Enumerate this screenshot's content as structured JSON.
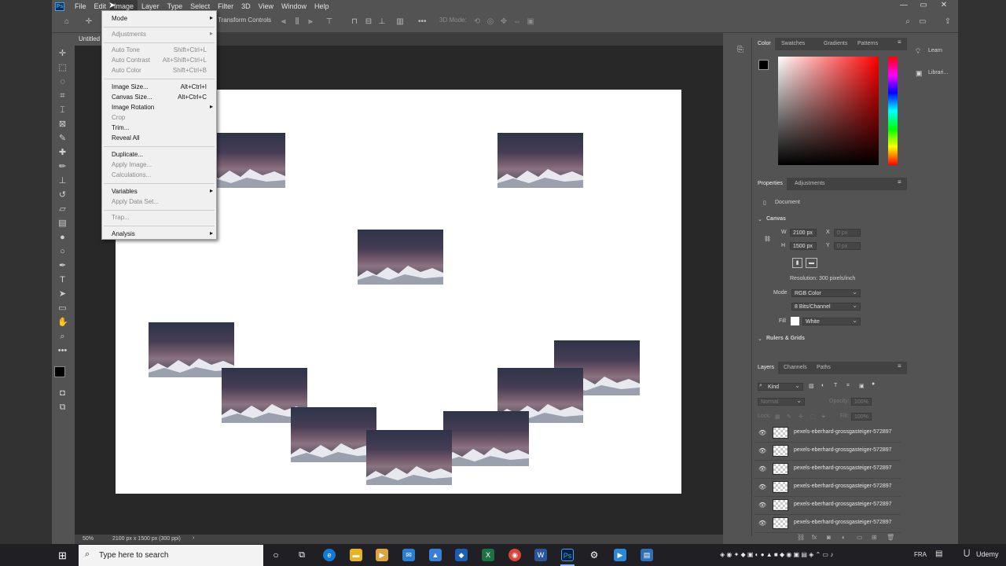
{
  "menubar": {
    "logo": "Ps",
    "items": [
      "File",
      "Edit",
      "Image",
      "Layer",
      "Type",
      "Select",
      "Filter",
      "3D",
      "View",
      "Window",
      "Help"
    ],
    "active": "Image",
    "window_controls": [
      "—",
      "▭",
      "✕"
    ]
  },
  "optionsbar": {
    "show_transform_controls": "Transform Controls",
    "mode_3d": "3D Mode:"
  },
  "document": {
    "tab_title": "Untitled"
  },
  "image_menu": {
    "items": [
      {
        "label": "Mode",
        "shortcut": "",
        "submenu": true,
        "enabled": true
      },
      {
        "label": "Adjustments",
        "shortcut": "",
        "submenu": true,
        "enabled": false
      },
      {
        "label": "Auto Tone",
        "shortcut": "Shift+Ctrl+L",
        "submenu": false,
        "enabled": false
      },
      {
        "label": "Auto Contrast",
        "shortcut": "Alt+Shift+Ctrl+L",
        "submenu": false,
        "enabled": false
      },
      {
        "label": "Auto Color",
        "shortcut": "Shift+Ctrl+B",
        "submenu": false,
        "enabled": false
      },
      {
        "label": "Image Size...",
        "shortcut": "Alt+Ctrl+I",
        "submenu": false,
        "enabled": true
      },
      {
        "label": "Canvas Size...",
        "shortcut": "Alt+Ctrl+C",
        "submenu": false,
        "enabled": true
      },
      {
        "label": "Image Rotation",
        "shortcut": "",
        "submenu": true,
        "enabled": true
      },
      {
        "label": "Crop",
        "shortcut": "",
        "submenu": false,
        "enabled": false
      },
      {
        "label": "Trim...",
        "shortcut": "",
        "submenu": false,
        "enabled": true
      },
      {
        "label": "Reveal All",
        "shortcut": "",
        "submenu": false,
        "enabled": true
      },
      {
        "label": "Duplicate...",
        "shortcut": "",
        "submenu": false,
        "enabled": true
      },
      {
        "label": "Apply Image...",
        "shortcut": "",
        "submenu": false,
        "enabled": false
      },
      {
        "label": "Calculations...",
        "shortcut": "",
        "submenu": false,
        "enabled": false
      },
      {
        "label": "Variables",
        "shortcut": "",
        "submenu": true,
        "enabled": true
      },
      {
        "label": "Apply Data Set...",
        "shortcut": "",
        "submenu": false,
        "enabled": false
      },
      {
        "label": "Trap...",
        "shortcut": "",
        "submenu": false,
        "enabled": false
      },
      {
        "label": "Analysis",
        "shortcut": "",
        "submenu": true,
        "enabled": true
      }
    ]
  },
  "color_panel": {
    "tabs": [
      "Color",
      "Swatches",
      "Gradients",
      "Patterns"
    ],
    "active_tab": "Color",
    "foreground": "#000000",
    "background": "#ffffff"
  },
  "properties_panel": {
    "tabs": [
      "Properties",
      "Adjustments"
    ],
    "active_tab": "Properties",
    "doc_label": "Document",
    "canvas_section": "Canvas",
    "width_label": "W",
    "width_value": "2100 px",
    "height_label": "H",
    "height_value": "1500 px",
    "x_label": "X",
    "x_placeholder": "0 px",
    "y_label": "Y",
    "y_placeholder": "0 px",
    "resolution": "Resolution: 300 pixels/inch",
    "mode_label": "Mode",
    "mode_value": "RGB Color",
    "depth_value": "8 Bits/Channel",
    "fill_label": "Fill",
    "fill_value": "White",
    "rulers_section": "Rulers & Grids"
  },
  "layers_panel": {
    "tabs": [
      "Layers",
      "Channels",
      "Paths"
    ],
    "active_tab": "Layers",
    "filter_kind": "Kind",
    "blend_mode": "Normal",
    "opacity_label": "Opacity:",
    "opacity_value": "100%",
    "lock_label": "Lock:",
    "fill_label": "Fill:",
    "fill_value": "100%",
    "layers": [
      {
        "name": "pexels-eberhard-grossgasteiger-572897"
      },
      {
        "name": "pexels-eberhard-grossgasteiger-572897"
      },
      {
        "name": "pexels-eberhard-grossgasteiger-572897"
      },
      {
        "name": "pexels-eberhard-grossgasteiger-572897"
      },
      {
        "name": "pexels-eberhard-grossgasteiger-572897"
      },
      {
        "name": "pexels-eberhard-grossgasteiger-572897"
      }
    ]
  },
  "learn_panel": {
    "items": [
      "Learn",
      "Librari..."
    ]
  },
  "statusbar": {
    "zoom": "50%",
    "doc_info": "2100 px x 1500 px (300 ppi)"
  },
  "taskbar": {
    "search_placeholder": "Type here to search",
    "language": "FRA",
    "watermark": "Udemy"
  },
  "icons": {
    "photo_thumb": "mountain-photo",
    "move_tool": "move-icon",
    "home": "home-icon"
  }
}
